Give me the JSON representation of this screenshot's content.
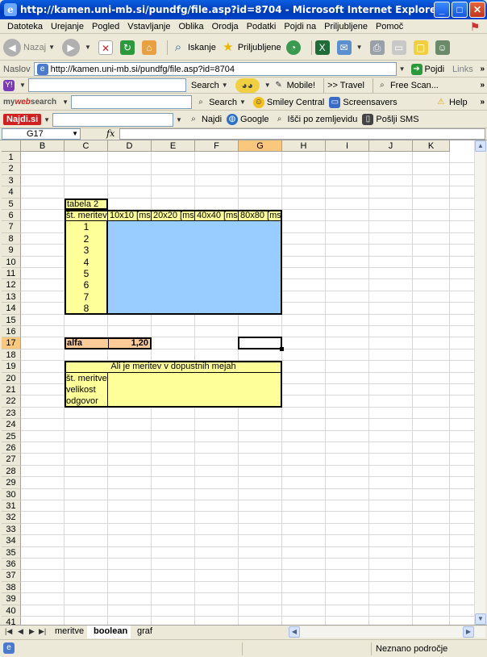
{
  "window": {
    "title": "http://kamen.uni-mb.si/pundfg/file.asp?id=8704 - Microsoft Internet Explorer"
  },
  "menu": [
    "Datoteka",
    "Urejanje",
    "Pogled",
    "Vstavljanje",
    "Oblika",
    "Orodja",
    "Podatki",
    "Pojdi na",
    "Priljubljene",
    "Pomoč"
  ],
  "toolbar": {
    "back_label": "Nazaj",
    "search_label": "Iskanje",
    "favorites_label": "Priljubljene"
  },
  "address": {
    "label": "Naslov",
    "url": "http://kamen.uni-mb.si/pundfg/file.asp?id=8704",
    "go_label": "Pojdi",
    "links_label": "Links"
  },
  "yahoo_bar": {
    "search_label": "Search",
    "mobile_label": "Mobile!",
    "travel_label": ">> Travel",
    "freescan_label": "Free Scan..."
  },
  "mywebsearch_bar": {
    "brand_my": "my",
    "brand_web": "web",
    "brand_search": "search",
    "search_label": "Search",
    "smiley_label": "Smiley Central",
    "screensavers_label": "Screensavers",
    "help_label": "Help"
  },
  "najdi_bar": {
    "brand": "Najdi.si",
    "najdi_label": "Najdi",
    "google_label": "Google",
    "zemljevid_label": "Išči po zemljevidu",
    "sms_label": "Pošlji SMS"
  },
  "formula_bar": {
    "cell_ref": "G17",
    "fx": "fx",
    "content": ""
  },
  "sheet": {
    "columns": [
      "B",
      "C",
      "D",
      "E",
      "F",
      "G",
      "H",
      "I",
      "J",
      "K"
    ],
    "selected_column": "G",
    "selected_row": "17",
    "rows": [
      "1",
      "2",
      "3",
      "4",
      "5",
      "6",
      "7",
      "8",
      "9",
      "10",
      "11",
      "12",
      "13",
      "14",
      "15",
      "16",
      "17",
      "18",
      "19",
      "20",
      "21",
      "22",
      "23",
      "24",
      "25",
      "26",
      "27",
      "28",
      "29",
      "30",
      "31",
      "32",
      "33",
      "34",
      "35",
      "36",
      "37",
      "38",
      "39",
      "40",
      "41"
    ],
    "table2": {
      "title": "tabela 2",
      "headers": [
        "št. meritev",
        "10x10 [ms]",
        "20x20 [ms]",
        "40x40 [ms]",
        "80x80 [ms]"
      ],
      "ids": [
        "1",
        "2",
        "3",
        "4",
        "5",
        "6",
        "7",
        "8"
      ]
    },
    "alfa": {
      "label": "alfa",
      "value": "1,20"
    },
    "check_table": {
      "title": "Ali je meritev v dopustnih mejah",
      "rows": [
        "št. meritve",
        "velikost",
        "odgovor"
      ]
    },
    "colors": {
      "yellow": "#ffff99",
      "blue": "#99ccff",
      "orange": "#ffcc99"
    }
  },
  "sheet_tabs": [
    "meritve",
    "boolean",
    "graf"
  ],
  "active_tab": "boolean",
  "status": {
    "zone": "Neznano področje"
  }
}
